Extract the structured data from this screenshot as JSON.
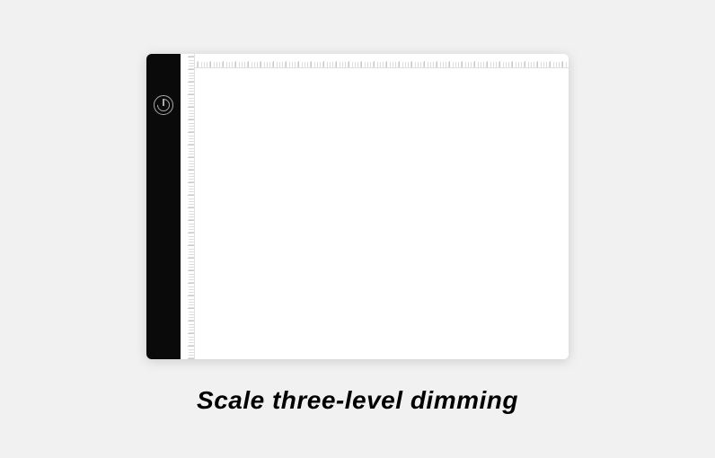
{
  "product": {
    "caption": "Scale three-level dimming",
    "power_button_name": "power-toggle"
  }
}
